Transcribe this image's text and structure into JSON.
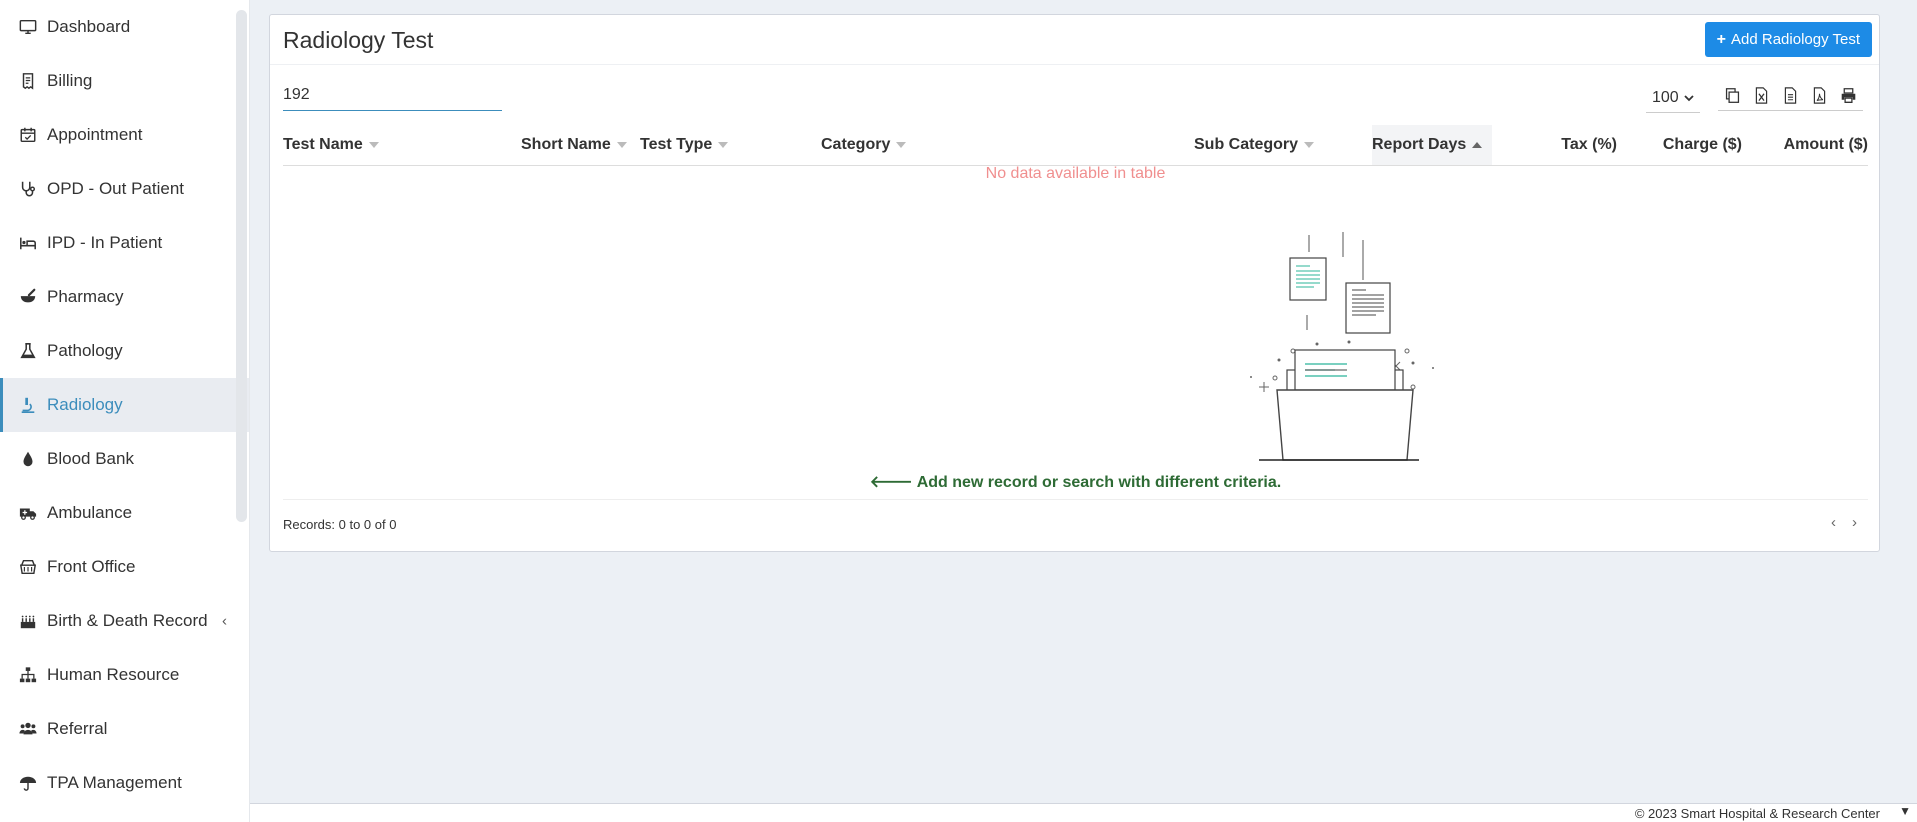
{
  "sidebar": {
    "items": [
      {
        "label": "Dashboard",
        "icon": "monitor-icon"
      },
      {
        "label": "Billing",
        "icon": "receipt-icon"
      },
      {
        "label": "Appointment",
        "icon": "calendar-check-icon"
      },
      {
        "label": "OPD - Out Patient",
        "icon": "stethoscope-icon"
      },
      {
        "label": "IPD - In Patient",
        "icon": "bed-icon"
      },
      {
        "label": "Pharmacy",
        "icon": "mortar-pestle-icon"
      },
      {
        "label": "Pathology",
        "icon": "flask-icon"
      },
      {
        "label": "Radiology",
        "icon": "microscope-icon",
        "active": true
      },
      {
        "label": "Blood Bank",
        "icon": "blood-drop-icon"
      },
      {
        "label": "Ambulance",
        "icon": "ambulance-icon"
      },
      {
        "label": "Front Office",
        "icon": "dumpster-icon"
      },
      {
        "label": "Birth & Death Record",
        "icon": "birthday-cake-icon"
      },
      {
        "label": "Human Resource",
        "icon": "sitemap-icon"
      },
      {
        "label": "Referral",
        "icon": "users-icon"
      },
      {
        "label": "TPA Management",
        "icon": "umbrella-icon"
      }
    ]
  },
  "panel": {
    "title": "Radiology Test",
    "add_button": "Add Radiology Test"
  },
  "search": {
    "value": "192",
    "placeholder": ""
  },
  "page_length": "100",
  "table": {
    "columns": [
      {
        "label": "Test Name",
        "sortable": true
      },
      {
        "label": "Short Name",
        "sortable": true
      },
      {
        "label": "Test Type",
        "sortable": true
      },
      {
        "label": "Category",
        "sortable": true
      },
      {
        "label": "Sub Category",
        "sortable": true
      },
      {
        "label": "Report Days",
        "sortable": true,
        "sorted": "asc"
      },
      {
        "label": "Tax (%)",
        "sortable": false
      },
      {
        "label": "Charge ($)",
        "sortable": false
      },
      {
        "label": "Amount ($)",
        "sortable": false
      }
    ],
    "empty_message": "No data available in table",
    "hint": "Add new record or search with different criteria.",
    "records_info": "Records: 0 to 0 of 0"
  },
  "footer": {
    "copyright": "© 2023 Smart Hospital & Research Center"
  },
  "colors": {
    "accent": "#3c8dbc",
    "button": "#1d8be6",
    "empty_text": "#f08f8f",
    "hint_text": "#2e6b35"
  }
}
